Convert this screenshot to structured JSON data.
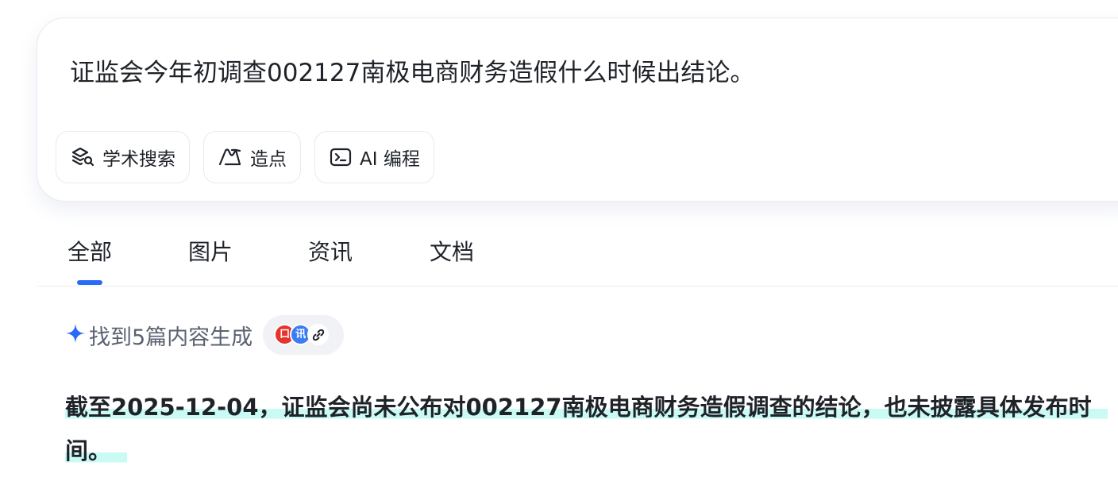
{
  "query": {
    "text": "证监会今年初调查002127南极电商财务造假什么时候出结论。",
    "tools": [
      {
        "label": "学术搜索",
        "icon": "academic-search-icon"
      },
      {
        "label": "造点",
        "icon": "create-point-icon"
      },
      {
        "label": "AI 编程",
        "icon": "terminal-icon"
      }
    ]
  },
  "tabs": [
    {
      "label": "全部",
      "active": true
    },
    {
      "label": "图片",
      "active": false
    },
    {
      "label": "资讯",
      "active": false
    },
    {
      "label": "文档",
      "active": false
    }
  ],
  "found": {
    "text": "找到5篇内容生成",
    "icon": "sparkle-icon",
    "sources": [
      {
        "label": "口",
        "color": "#e8332b"
      },
      {
        "label": "讯",
        "color": "#3b7cf5"
      },
      {
        "icon": "link-icon"
      }
    ]
  },
  "answer": {
    "text": "截至2025-12-04，证监会尚未公布对002127南极电商财务造假调查的结论，也未披露具体发布时间。"
  },
  "colors": {
    "accent": "#2a6bf5",
    "highlight": "#c9fbf4",
    "text": "#1f2329",
    "muted": "#5b6270"
  }
}
